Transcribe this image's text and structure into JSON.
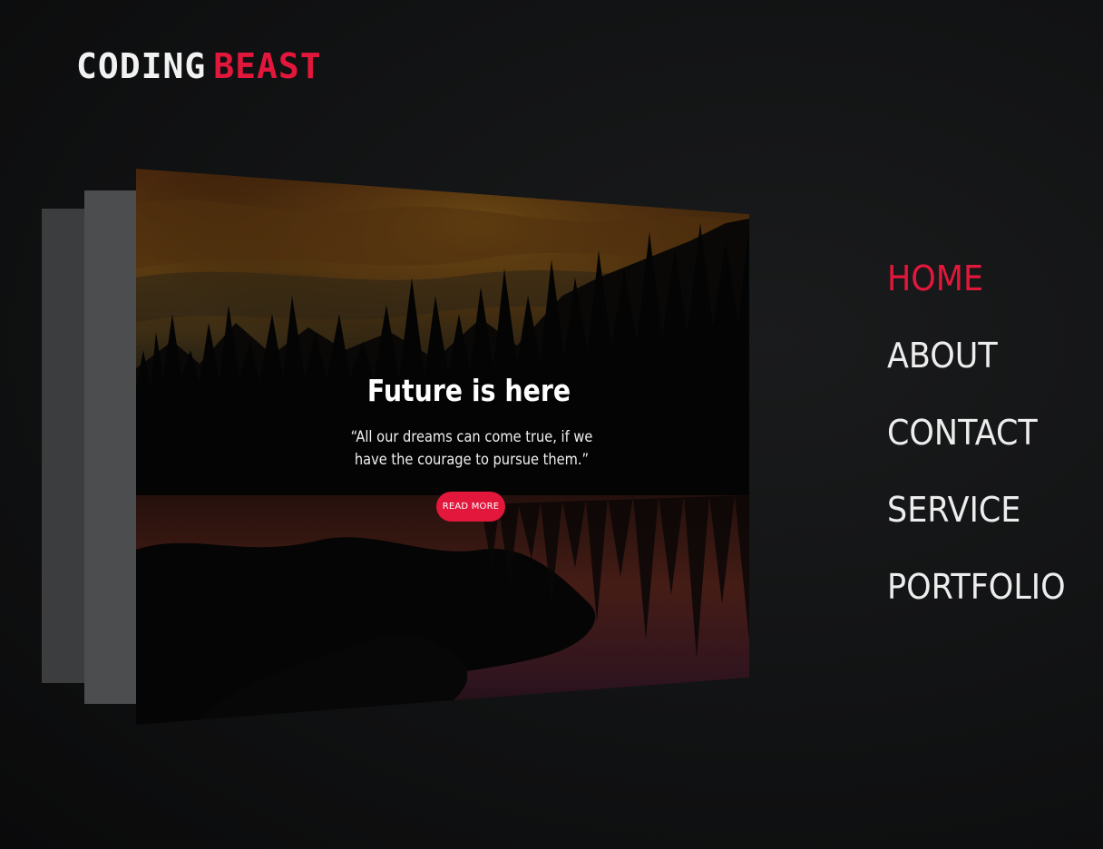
{
  "logo": {
    "part1": "CODING",
    "part2": "BEAST"
  },
  "hero": {
    "title": "Future is here",
    "quote": "“All our dreams can come true, if we have the courage to pursue them.”",
    "button_label": "READ MORE"
  },
  "nav": {
    "items": [
      {
        "label": "HOME",
        "active": true
      },
      {
        "label": "ABOUT",
        "active": false
      },
      {
        "label": "CONTACT",
        "active": false
      },
      {
        "label": "SERVICE",
        "active": false
      },
      {
        "label": "PORTFOLIO",
        "active": false
      }
    ]
  },
  "colors": {
    "accent": "#e3173c",
    "background": "#111213",
    "text": "#ededed"
  }
}
